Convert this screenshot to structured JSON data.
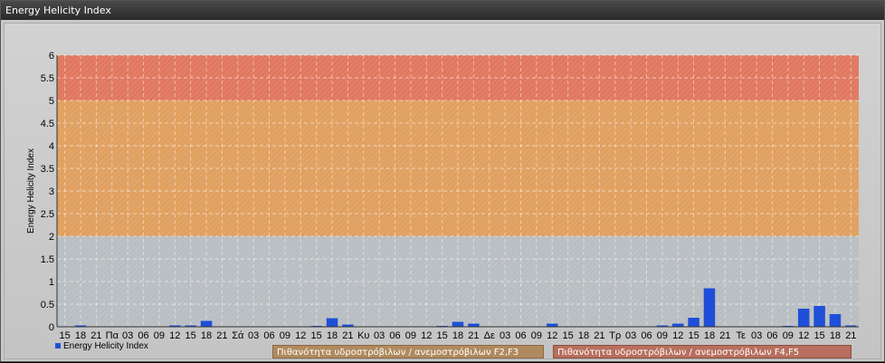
{
  "window": {
    "title": "Energy Helicity Index"
  },
  "chart_data": {
    "type": "bar",
    "ylabel": "Energy Helicity Index",
    "xlabel": "",
    "ylim": [
      0,
      6
    ],
    "yticks": [
      0,
      0.5,
      1,
      1.5,
      2,
      2.5,
      3,
      3.5,
      4,
      4.5,
      5,
      5.5,
      6
    ],
    "grid": true,
    "categories": [
      "15",
      "18",
      "21",
      "Πα",
      "03",
      "06",
      "09",
      "12",
      "15",
      "18",
      "21",
      "Σά",
      "03",
      "06",
      "09",
      "12",
      "15",
      "18",
      "21",
      "Κυ",
      "03",
      "06",
      "09",
      "12",
      "15",
      "18",
      "21",
      "Δε",
      "03",
      "06",
      "09",
      "12",
      "15",
      "18",
      "21",
      "Τρ",
      "03",
      "06",
      "09",
      "12",
      "15",
      "18",
      "21",
      "Τε",
      "03",
      "06",
      "09",
      "12",
      "15",
      "18",
      "21"
    ],
    "series": [
      {
        "name": "Energy Helicity Index",
        "color": "#1f4fd8",
        "values": [
          0.01,
          0.03,
          0.01,
          0.01,
          0.01,
          0.01,
          0.01,
          0.03,
          0.03,
          0.13,
          0.01,
          0.01,
          0.01,
          0.01,
          0.01,
          0.01,
          0.02,
          0.19,
          0.05,
          0.01,
          0.01,
          0.01,
          0.01,
          0.01,
          0.02,
          0.11,
          0.07,
          0.01,
          0.01,
          0.01,
          0.01,
          0.07,
          0.01,
          0.01,
          0.01,
          0.01,
          0.01,
          0.01,
          0.03,
          0.07,
          0.2,
          0.85,
          0.01,
          0.01,
          0.01,
          0.01,
          0.02,
          0.4,
          0.46,
          0.28,
          0.03
        ]
      }
    ],
    "bands": [
      {
        "from": 2,
        "to": 5,
        "color": "#e0a060",
        "label": "Πιθανότητα υδροστρόβιλων / ανεμοστρόβιλων F2,F3"
      },
      {
        "from": 5,
        "to": 6,
        "color": "#e07860",
        "label": "Πιθανότητα υδροστρόβιλων / ανεμοστρόβιλων F4,F5"
      }
    ],
    "legend": "bottom-left"
  }
}
